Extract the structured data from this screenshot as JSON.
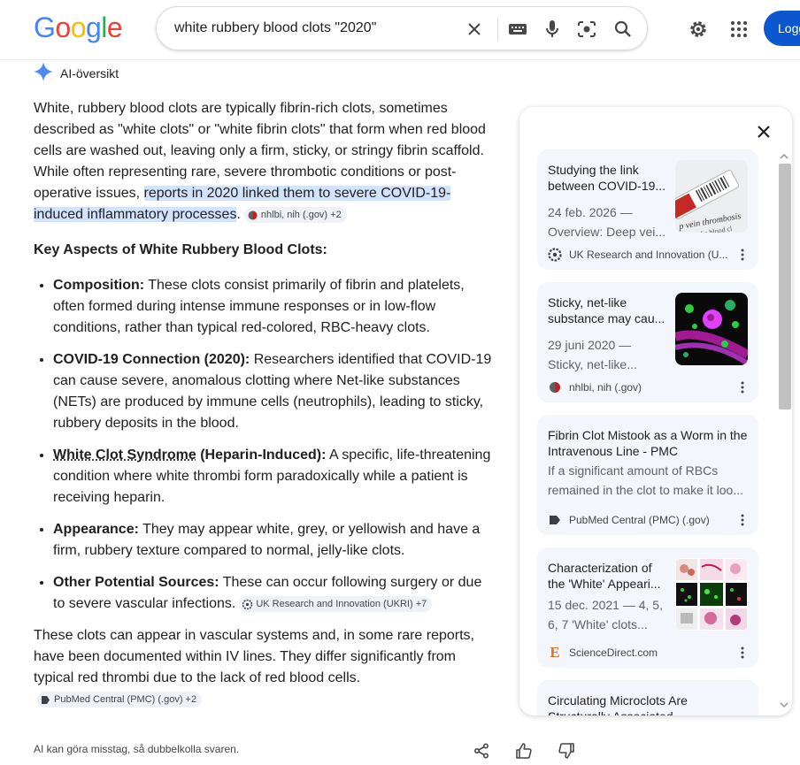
{
  "header": {
    "logo": [
      "G",
      "o",
      "o",
      "g",
      "l",
      "e"
    ],
    "logo_colors": [
      "#4285f4",
      "#ea4335",
      "#fbbc05",
      "#4285f4",
      "#34a853",
      "#ea4335"
    ],
    "search_query": "white rubbery blood clots \"2020\"",
    "login_label": "Logga in"
  },
  "ai_overview": {
    "label": "AI-översikt",
    "intro_text": "White, rubbery blood clots are typically fibrin-rich clots, sometimes described as \"white clots\" or \"white fibrin clots\" that form when red blood cells are washed out, leaving only a firm, sticky, or stringy fibrin scaffold. While often representing rare, severe thrombotic conditions or post-operative issues, ",
    "intro_highlight": "reports in 2020 linked them to severe COVID-19-induced inflammatory processes",
    "intro_end": ".",
    "intro_chip": "nhlbi, nih (.gov) +2",
    "key_heading": "Key Aspects of White Rubbery Blood Clots:",
    "bullets": [
      {
        "term": "Composition:",
        "text": " These clots consist primarily of fibrin and platelets, often formed during intense immune responses or in low-flow conditions, rather than typical red-colored, RBC-heavy clots."
      },
      {
        "term": "COVID-19 Connection (2020):",
        "text": " Researchers identified that COVID-19 can cause severe, anomalous clotting where Net-like substances (NETs) are produced by immune cells (neutrophils), leading to sticky, rubbery deposits in the blood."
      },
      {
        "term_link": "White Clot Syndrome",
        "term": " (Heparin-Induced):",
        "text": " A specific, life-threatening condition where white thrombi form paradoxically while a patient is receiving heparin."
      },
      {
        "term": "Appearance:",
        "text": " They may appear white, grey, or yellowish and have a firm, rubbery texture compared to normal, jelly-like clots."
      },
      {
        "term": "Other Potential Sources:",
        "text": " These can occur following surgery or due to severe vascular infections.",
        "chip": "UK Research and Innovation (UKRI) +7"
      }
    ],
    "closing_text": "These clots can appear in vascular systems and, in some rare reports, have been documented within IV lines. They differ significantly from typical red thrombi due to the lack of red blood cells.",
    "closing_chip": "PubMed Central (PMC) (.gov) +2"
  },
  "sources": [
    {
      "title": "Studying the link between COVID-19...",
      "snippet": "24 feb. 2026 — Overview: Deep vei...",
      "source": "UK Research and Innovation (U...",
      "icon": "ukri-icon"
    },
    {
      "title": "Sticky, net-like substance may cau...",
      "snippet": "29 juni 2020 — Sticky, net-like...",
      "source": "nhlbi, nih (.gov)",
      "icon": "nhlbi-icon"
    },
    {
      "title": "Fibrin Clot Mistook as a Worm in the Intravenous Line - PMC",
      "snippet": "If a significant amount of RBCs remained in the clot to make it loo...",
      "source": "PubMed Central (PMC) (.gov)",
      "icon": "pmc-icon"
    },
    {
      "title": "Characterization of the 'White' Appeari...",
      "snippet": "15 dec. 2021 — 4, 5, 6, 7 'White' clots...",
      "source": "ScienceDirect.com",
      "icon": "sciencedirect-icon"
    },
    {
      "title": "Circulating Microclots Are Structurally Associated With...",
      "snippet": "",
      "source": "",
      "icon": ""
    }
  ],
  "thumb_text": {
    "vein": "p vein thrombosis",
    "sub": "ation of a blood cl"
  },
  "footer": {
    "note": "AI kan göra misstag, så dubbelkolla svaren."
  }
}
